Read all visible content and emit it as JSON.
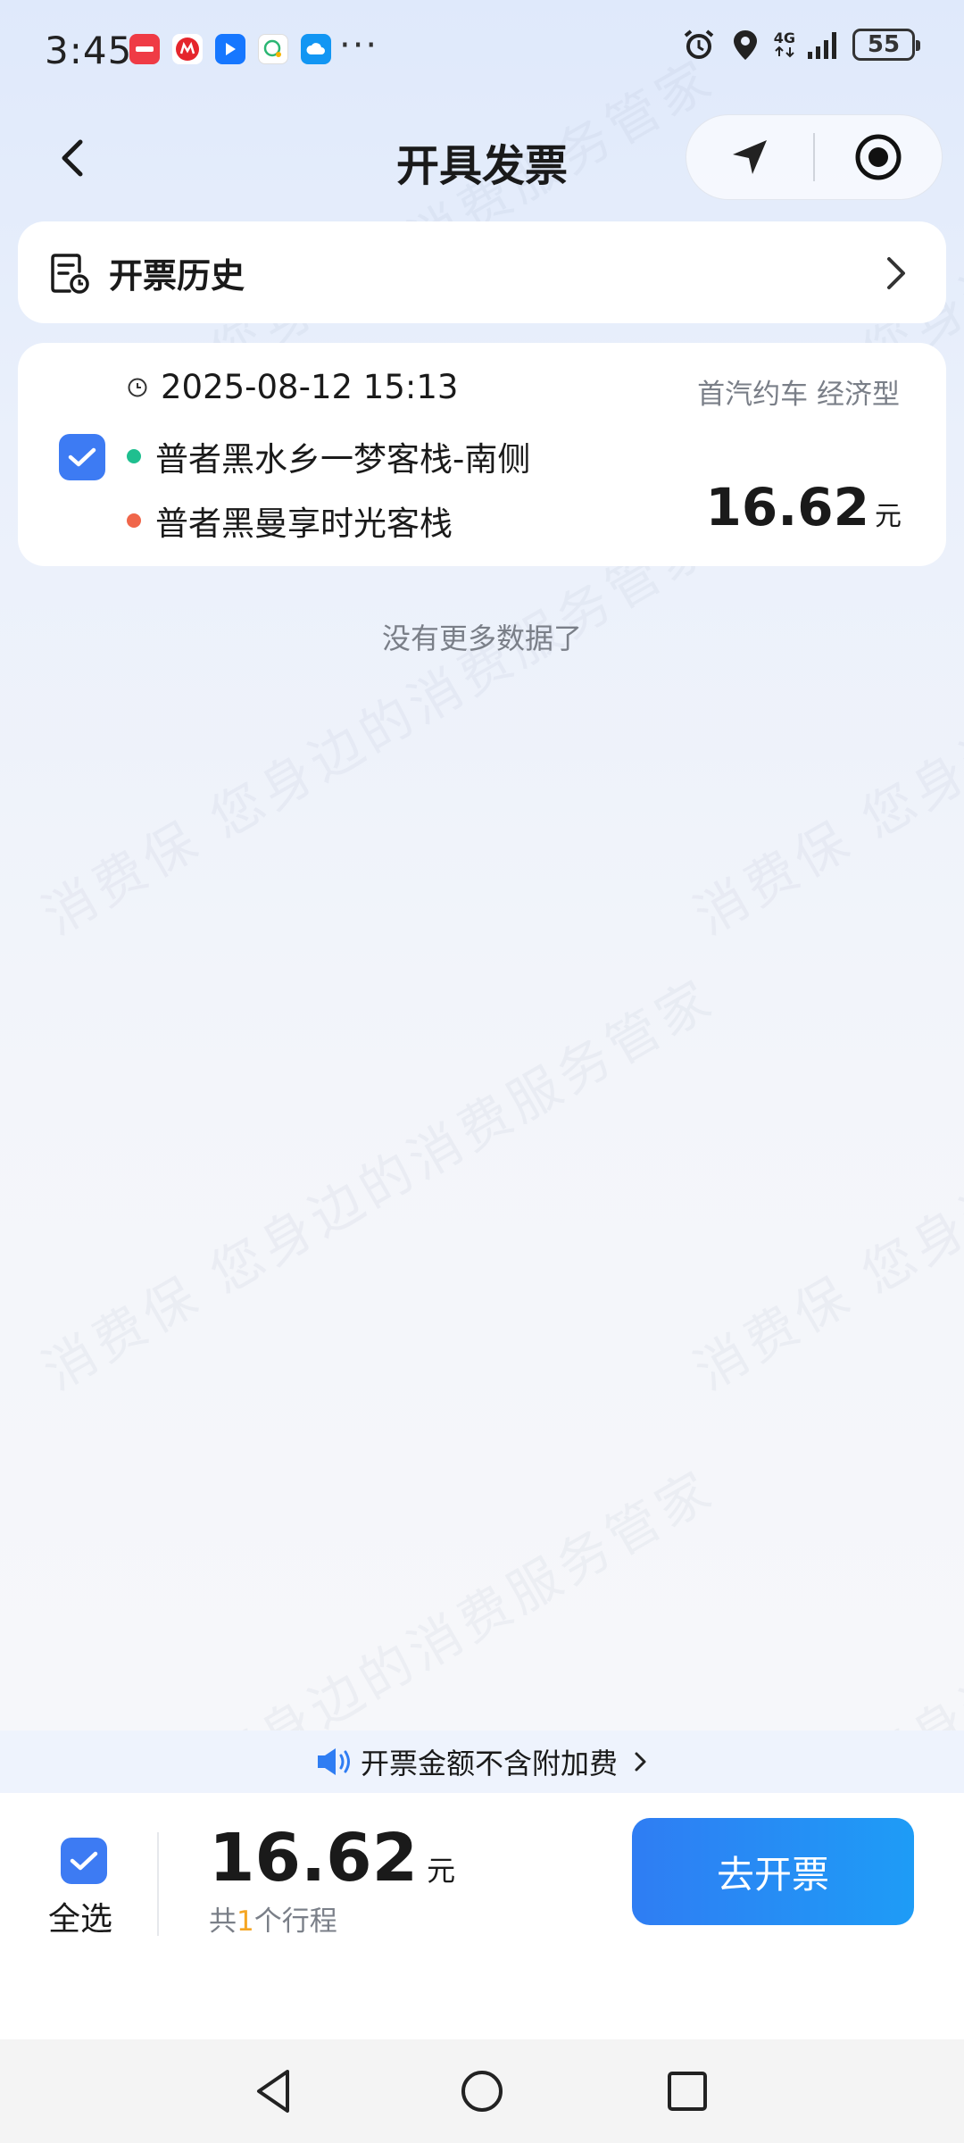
{
  "status_bar": {
    "time": "3:45",
    "network": "4G",
    "battery": "55",
    "notification_icons": [
      {
        "name": "huawei-icon",
        "color": "#ef3b45"
      },
      {
        "name": "cmb-bank-icon",
        "color": "#e5252c"
      },
      {
        "name": "map-icon",
        "color": "#1677ff"
      },
      {
        "name": "chat-icon",
        "color": "#2bb673"
      },
      {
        "name": "cloud-icon",
        "color": "#1296f3"
      }
    ],
    "more": "···"
  },
  "nav": {
    "title": "开具发票"
  },
  "history": {
    "label": "开票历史"
  },
  "trips": [
    {
      "time": "2025-08-12 15:13",
      "service": "首汽约车 经济型",
      "start": "普者黑水乡一梦客栈-南侧",
      "end": "普者黑曼享时光客栈",
      "price": "16.62",
      "unit": "元",
      "selected": true
    }
  ],
  "list_end": "没有更多数据了",
  "watermark": "消费保 您身边的消费服务管家",
  "notice": {
    "text": "开票金额不含附加费"
  },
  "bottom": {
    "select_all": "全选",
    "total": "16.62",
    "unit": "元",
    "count_prefix": "共",
    "count": "1",
    "count_suffix": "个行程",
    "button": "去开票"
  },
  "colors": {
    "accent": "#3d7bf3",
    "start_dot": "#1fbf8f",
    "end_dot": "#f0664a",
    "count_highlight": "#f5a623"
  }
}
